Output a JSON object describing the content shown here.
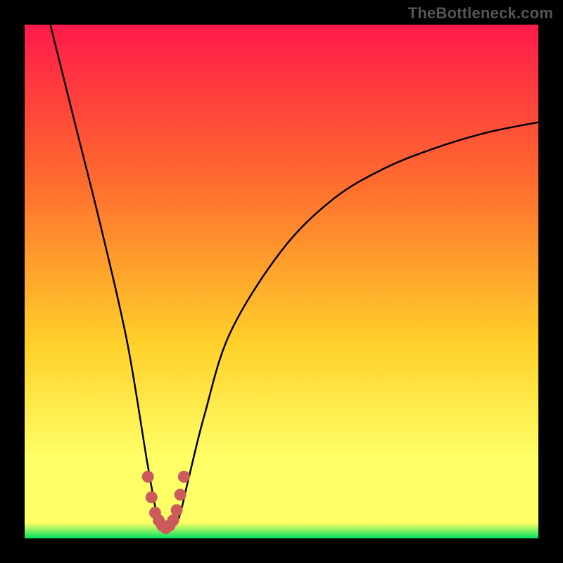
{
  "watermark": "TheBottleneck.com",
  "colors": {
    "page_bg": "#000000",
    "gradient_top": "#ff1a4a",
    "gradient_mid_upper": "#ff6a2f",
    "gradient_mid": "#ffd02a",
    "gradient_band": "#ffff66",
    "gradient_bottom": "#00e060",
    "curve_stroke": "#000000",
    "marker_stroke": "#cc5a5a"
  },
  "chart_data": {
    "type": "line",
    "title": "",
    "xlabel": "",
    "ylabel": "",
    "x_range": [
      0,
      100
    ],
    "y_range": [
      0,
      100
    ],
    "series": [
      {
        "name": "bottleneck-curve",
        "x": [
          5,
          10,
          15,
          20,
          24,
          26,
          28,
          30,
          32,
          35,
          40,
          50,
          60,
          70,
          80,
          90,
          100
        ],
        "y": [
          100,
          80,
          60,
          38,
          14,
          4,
          2,
          4,
          12,
          24,
          40,
          56,
          66,
          72,
          76,
          79,
          81
        ]
      }
    ],
    "markers": {
      "name": "bottom-dots",
      "x": [
        24.0,
        24.7,
        25.4,
        26.1,
        26.8,
        27.5,
        28.2,
        28.9,
        29.6,
        30.3,
        31.0
      ],
      "y": [
        12.0,
        8.0,
        5.0,
        3.5,
        2.5,
        2.0,
        2.5,
        3.5,
        5.5,
        8.5,
        12.0
      ]
    }
  }
}
